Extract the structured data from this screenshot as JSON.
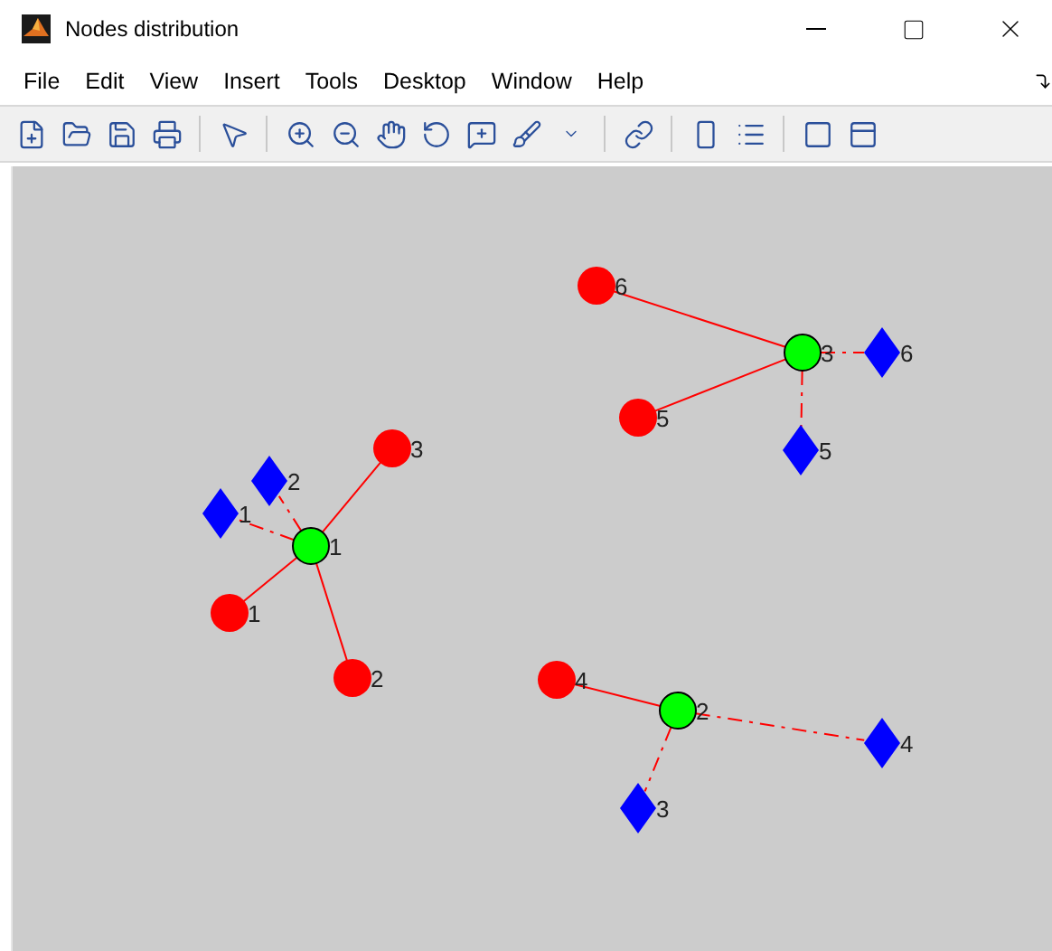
{
  "window": {
    "title": "Nodes distribution"
  },
  "menu": [
    "File",
    "Edit",
    "View",
    "Insert",
    "Tools",
    "Desktop",
    "Window",
    "Help"
  ],
  "nodes": [
    {
      "kind": "head",
      "label": "1"
    },
    {
      "kind": "head",
      "label": "2"
    },
    {
      "kind": "head",
      "label": "3"
    },
    {
      "kind": "sensor",
      "label": "1"
    },
    {
      "kind": "sensor",
      "label": "2"
    },
    {
      "kind": "sensor",
      "label": "3"
    },
    {
      "kind": "sensor",
      "label": "4"
    },
    {
      "kind": "sensor",
      "label": "5"
    },
    {
      "kind": "sensor",
      "label": "6"
    },
    {
      "kind": "actuator",
      "label": "1"
    },
    {
      "kind": "actuator",
      "label": "2"
    },
    {
      "kind": "actuator",
      "label": "3"
    },
    {
      "kind": "actuator",
      "label": "4"
    },
    {
      "kind": "actuator",
      "label": "5"
    },
    {
      "kind": "actuator",
      "label": "6"
    }
  ]
}
